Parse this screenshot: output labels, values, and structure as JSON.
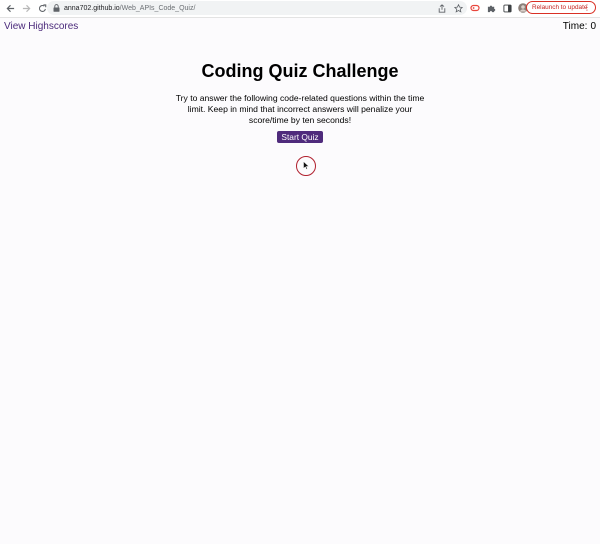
{
  "browser": {
    "url_host": "anna702.github.io",
    "url_path": "/Web_APIs_Code_Quiz/",
    "relaunch_label": "Relaunch to update",
    "relaunch_menu": "⋮",
    "icons": {
      "back": "arrow-left-icon",
      "forward": "arrow-right-icon",
      "reload": "reload-icon",
      "lock": "lock-icon",
      "share": "share-icon",
      "bookmark": "star-icon",
      "extension_1": "extension-icon",
      "extensions": "puzzle-icon",
      "sidebar": "sidebar-icon",
      "profile": "avatar-icon"
    },
    "colors": {
      "relaunch": "#d93025",
      "omnibox": "#f1f3f4"
    }
  },
  "header": {
    "highscores_link": "View Highscores",
    "timer_label": "Time:",
    "timer_value": "0"
  },
  "main": {
    "title": "Coding Quiz Challenge",
    "description": "Try to answer the following code-related questions within the time limit. Keep in mind that incorrect answers will penalize your score/time by ten seconds!",
    "start_button": "Start Quiz"
  },
  "colors": {
    "accent": "#4f2b7c",
    "link": "#4b2a7b",
    "cursor_ring": "#b0202e",
    "page_background": "#fcfbfd"
  }
}
